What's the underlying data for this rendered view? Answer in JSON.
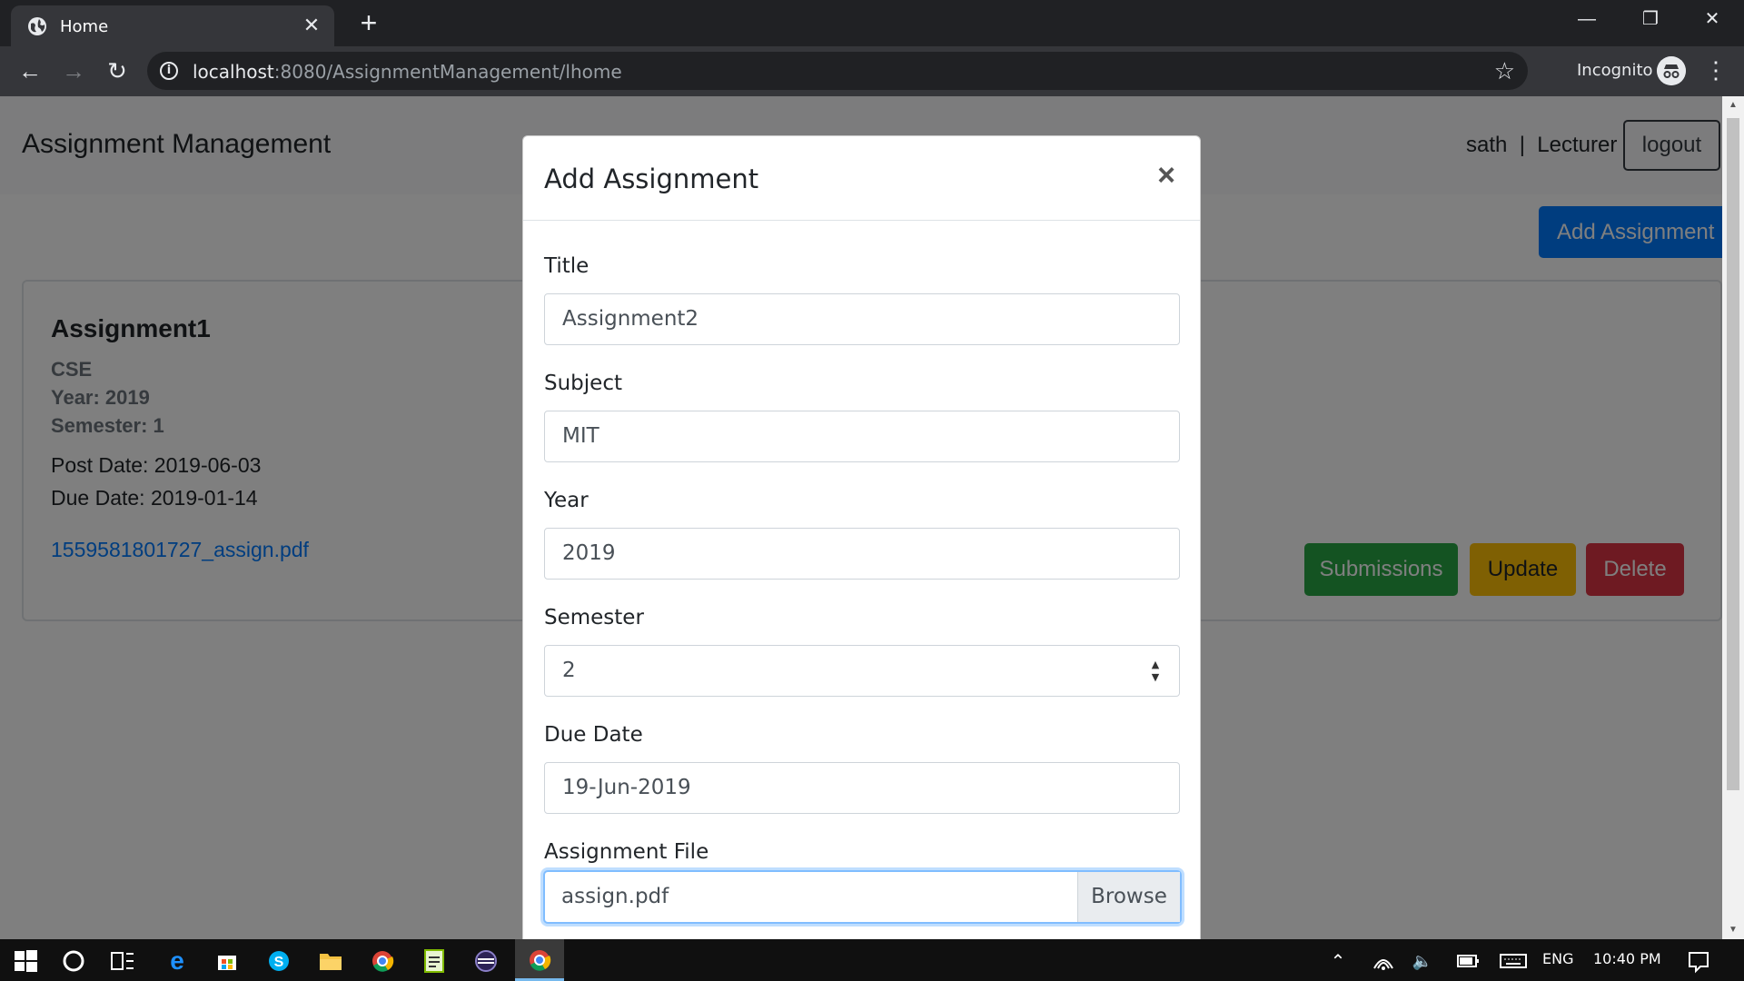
{
  "browser": {
    "tab_title": "Home",
    "tab_close": "✕",
    "new_tab": "+",
    "url_host": "localhost",
    "url_rest": ":8080/AssignmentManagement/lhome",
    "incognito_label": "Incognito",
    "window_controls": {
      "minimize": "—",
      "restore": "❐",
      "close": "✕"
    }
  },
  "page": {
    "brand": "Assignment Management",
    "user_info": "sath  |  Lecturer",
    "logout": "logout",
    "add_assignment": "Add Assignment",
    "card": {
      "title": "Assignment1",
      "subject": "CSE",
      "year": "Year: 2019",
      "semester": "Semester: 1",
      "post_date": "Post Date: 2019-06-03",
      "due_date": "Due Date: 2019-01-14",
      "file_link": "1559581801727_assign.pdf",
      "buttons": {
        "submissions": "Submissions",
        "update": "Update",
        "delete": "Delete"
      }
    }
  },
  "modal": {
    "title": "Add Assignment",
    "close": "×",
    "fields": {
      "title_label": "Title",
      "title_value": "Assignment2",
      "subject_label": "Subject",
      "subject_value": "MIT",
      "year_label": "Year",
      "year_value": "2019",
      "semester_label": "Semester",
      "semester_value": "2",
      "due_label": "Due Date",
      "due_value": "19-Jun-2019",
      "file_label": "Assignment File",
      "file_value": "assign.pdf",
      "browse": "Browse"
    }
  },
  "taskbar": {
    "lang": "ENG",
    "time": "10:40 PM"
  },
  "colors": {
    "primary": "#007bff",
    "success": "#28a745",
    "warning": "#ffc107",
    "danger": "#dc3545"
  }
}
